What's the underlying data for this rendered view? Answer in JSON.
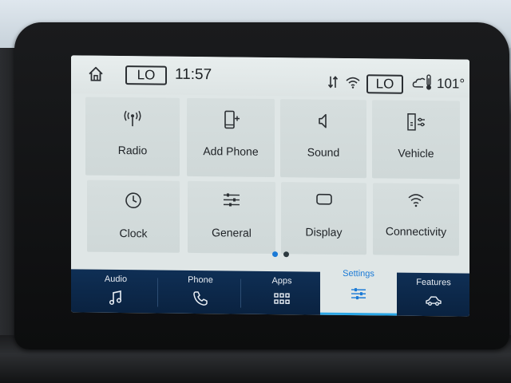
{
  "status_bar": {
    "climate_left": "LO",
    "time": "11:57",
    "climate_right": "LO",
    "outside_temp": "101°",
    "icons": [
      "home-icon",
      "sort-icon",
      "wifi-icon",
      "weather-thermometer-icon"
    ]
  },
  "tiles": [
    {
      "label": "Radio",
      "icon": "antenna-icon"
    },
    {
      "label": "Add Phone",
      "icon": "add-phone-icon"
    },
    {
      "label": "Sound",
      "icon": "speaker-icon"
    },
    {
      "label": "Vehicle",
      "icon": "vehicle-settings-icon"
    },
    {
      "label": "Clock",
      "icon": "clock-icon"
    },
    {
      "label": "General",
      "icon": "sliders-icon"
    },
    {
      "label": "Display",
      "icon": "display-icon"
    },
    {
      "label": "Connectivity",
      "icon": "wifi-icon"
    }
  ],
  "page_indicator": {
    "current": 1,
    "total": 2
  },
  "nav": [
    {
      "label": "Audio",
      "icon": "music-note-icon"
    },
    {
      "label": "Phone",
      "icon": "phone-handset-icon"
    },
    {
      "label": "Apps",
      "icon": "apps-grid-icon"
    },
    {
      "label": "Settings",
      "icon": "settings-sliders-icon",
      "active": true
    },
    {
      "label": "Features",
      "icon": "car-icon"
    }
  ],
  "colors": {
    "screen_bg": "#dfe6e6",
    "tile_bg": "#d4dcdc",
    "nav_bg": "#0f2f55",
    "accent": "#1b7ad6",
    "dot_active": "#1b7ad6",
    "dot_inactive": "#2d3a40"
  }
}
